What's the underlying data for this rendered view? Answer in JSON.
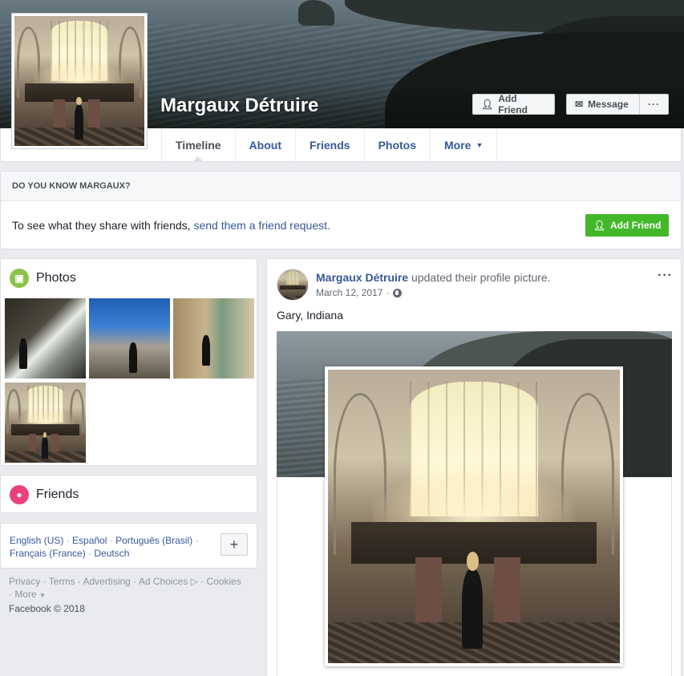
{
  "profile": {
    "name": "Margaux Détruire",
    "add_friend_label": "Add Friend",
    "message_label": "Message",
    "more_label": "···"
  },
  "nav": {
    "tabs": [
      {
        "label": "Timeline"
      },
      {
        "label": "About"
      },
      {
        "label": "Friends"
      },
      {
        "label": "Photos"
      },
      {
        "label": "More"
      }
    ]
  },
  "know": {
    "header": "DO YOU KNOW MARGAUX?",
    "text_prefix": "To see what they share with friends,",
    "link": "send them a friend request.",
    "button": "Add Friend"
  },
  "photos": {
    "title": "Photos"
  },
  "friends": {
    "title": "Friends"
  },
  "languages": {
    "items": [
      "English (US)",
      "Español",
      "Português (Brasil)",
      "Français (France)",
      "Deutsch"
    ],
    "plus": "+"
  },
  "footer": {
    "links": [
      "Privacy",
      "Terms",
      "Advertising",
      "Ad Choices",
      "Cookies",
      "More"
    ],
    "copyright": "Facebook © 2018"
  },
  "post": {
    "author": "Margaux Détruire",
    "action": "updated their profile picture.",
    "date": "March 12, 2017",
    "text": "Gary, Indiana",
    "menu": "···"
  },
  "colors": {
    "link": "#365899",
    "green": "#42b72a",
    "background": "#e9ebee"
  }
}
